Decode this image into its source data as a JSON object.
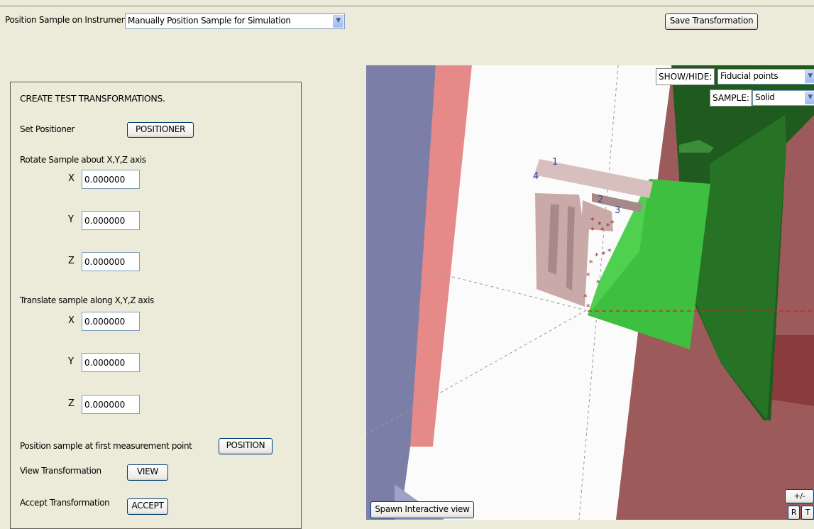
{
  "toolbar": {
    "label": "Position Sample on Instrument",
    "mode_value": "Manually Position Sample for Simulation",
    "save_label": "Save Transformation"
  },
  "panel": {
    "title": "CREATE TEST TRANSFORMATIONS.",
    "set_positioner_label": "Set Positioner",
    "positioner_button": "POSITIONER",
    "rotate_label": "Rotate Sample about X,Y,Z axis",
    "translate_label": "Translate sample along X,Y,Z axis",
    "axis_x": "X",
    "axis_y": "Y",
    "axis_z": "Z",
    "rot_x": "0.000000",
    "rot_y": "0.000000",
    "rot_z": "0.000000",
    "trans_x": "0.000000",
    "trans_y": "0.000000",
    "trans_z": "0.000000",
    "position_label": "Position sample at first measurement point",
    "position_button": "POSITION",
    "view_label": "View Transformation",
    "view_button": "VIEW",
    "accept_label": "Accept Transformation",
    "accept_button": "ACCEPT"
  },
  "viewport": {
    "showhide_label": "SHOW/HIDE:",
    "showhide_value": "Fiducial points",
    "sample_label": "SAMPLE:",
    "sample_value": "Solid",
    "spawn_button": "Spawn Interactive view",
    "zoom_button": "+/-",
    "r_button": "R",
    "t_button": "T",
    "fiducial_labels": [
      "1",
      "2",
      "3",
      "4"
    ]
  },
  "colors": {
    "background": "#ecebd9",
    "bench_blue": "#7b7fa8",
    "salmon": "#e58a89",
    "instrument_red": "#9c5a5a",
    "dark_green": "#1f5a1f",
    "bright_green": "#3fbf3f",
    "sample": "#c9aaa8"
  }
}
